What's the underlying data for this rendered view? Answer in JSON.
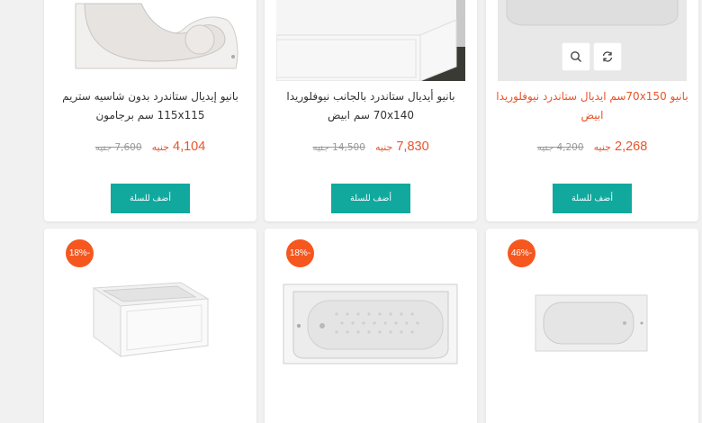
{
  "products_top": [
    {
      "title_line1": "بانيو إيديال ستاندرد بدون شاسيه ستريم",
      "title_line2": "115x115 سم برجامون",
      "price": "4,104",
      "old_price": "7,600 جنيه",
      "currency": "جنيه",
      "button": "أضف للسلة",
      "image_icon": "corner-bathtub-image"
    },
    {
      "title_line1": "بانيو أيديال ستاندرد بالجانب نيوفلوريدا",
      "title_line2": "70x140 سم ابيض",
      "price": "7,830",
      "old_price": "14,500 جنيه",
      "currency": "جنيه",
      "button": "أضف للسلة",
      "image_icon": "bathtub-with-panel-image"
    },
    {
      "title_line1": "بانيو 70x150سم ايديال ستاندرد نيوفلوريدا",
      "title_line2": "ابيض",
      "price": "2,268",
      "old_price": "4,200 جنيه",
      "currency": "جنيه",
      "button": "أضف للسلة",
      "image_icon": "rectangular-bathtub-image"
    }
  ],
  "products_bottom": [
    {
      "badge": "18%-",
      "image_icon": "panel-bathtub-image"
    },
    {
      "badge": "18%-",
      "image_icon": "anti-slip-bathtub-image"
    },
    {
      "badge": "46%-",
      "image_icon": "small-bathtub-image"
    }
  ],
  "icons": {
    "quick_view": "search-icon",
    "compare": "refresh-icon"
  },
  "colors": {
    "accent": "#e8542a",
    "button": "#11a89e",
    "badge": "#f5571f"
  }
}
